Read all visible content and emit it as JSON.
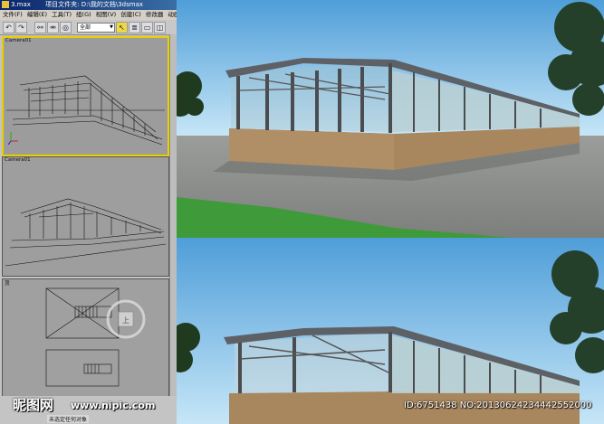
{
  "app": {
    "file_name": "3.max",
    "project_label": "项目文件夹:",
    "project_path": "D:\\我的文档\\3dsmax"
  },
  "menu": [
    "文件(F)",
    "编辑(E)",
    "工具(T)",
    "组(G)",
    "视图(V)",
    "创建(C)",
    "修改器",
    "动画"
  ],
  "toolbar": {
    "selection_filter": "全部"
  },
  "viewports": [
    {
      "label": "Camera01"
    },
    {
      "label": "Camera01"
    },
    {
      "label": "顶"
    }
  ],
  "status": {
    "message": "未选定任何对象"
  },
  "watermarks": {
    "site_name": "昵图网",
    "url": "www.nipic.com",
    "image_id": "ID:6751438 NO:20130624234442552000"
  },
  "colors": {
    "sky_top": "#5aa6df",
    "sky_bottom": "#bfe2f7",
    "ground": "#8a8c8a",
    "grass": "#3f9a3a",
    "stone": "#a8865e",
    "frame": "#4a4c50",
    "glass": "#b9cfd2",
    "active_viewport": "#e8d000"
  }
}
